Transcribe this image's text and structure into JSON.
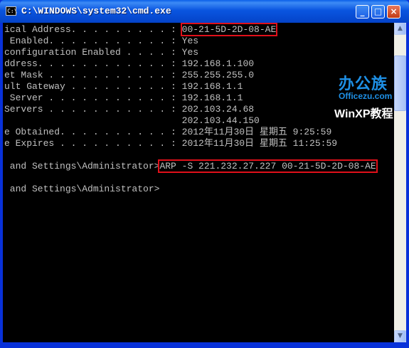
{
  "window": {
    "title": "C:\\WINDOWS\\system32\\cmd.exe",
    "icon_label": "C:\\"
  },
  "title_buttons": {
    "minimize": "_",
    "maximize": "□",
    "close": "×"
  },
  "console": {
    "lines": [
      {
        "prefix": "ical Address. . . . . . . . . : ",
        "value": "00-21-5D-2D-08-AE"
      },
      {
        "text": " Enabled. . . . . . . . . . . : Yes"
      },
      {
        "text": "configuration Enabled . . . . : Yes"
      },
      {
        "text": "ddress. . . . . . . . . . . . : 192.168.1.100"
      },
      {
        "text": "et Mask . . . . . . . . . . . : 255.255.255.0"
      },
      {
        "text": "ult Gateway . . . . . . . . . : 192.168.1.1"
      },
      {
        "text": " Server . . . . . . . . . . . : 192.168.1.1"
      },
      {
        "text": "Servers . . . . . . . . . . . : 202.103.24.68"
      },
      {
        "text": "                                202.103.44.150"
      },
      {
        "text": "e Obtained. . . . . . . . . . : 2012年11月30日 星期五 9:25:59"
      },
      {
        "text": "e Expires . . . . . . . . . . : 2012年11月30日 星期五 11:25:59"
      },
      {
        "text": ""
      },
      {
        "prefix": " and Settings\\Administrator>",
        "value": "ARP -S 221.232.27.227 00-21-5D-2D-08-AE"
      },
      {
        "text": ""
      },
      {
        "text": " and Settings\\Administrator>"
      }
    ]
  },
  "scrollbar": {
    "up": "▲",
    "down": "▼"
  },
  "watermark": {
    "brand_cn": "办公族",
    "brand_url": "Officezu.com",
    "tagline": "WinXP教程"
  }
}
